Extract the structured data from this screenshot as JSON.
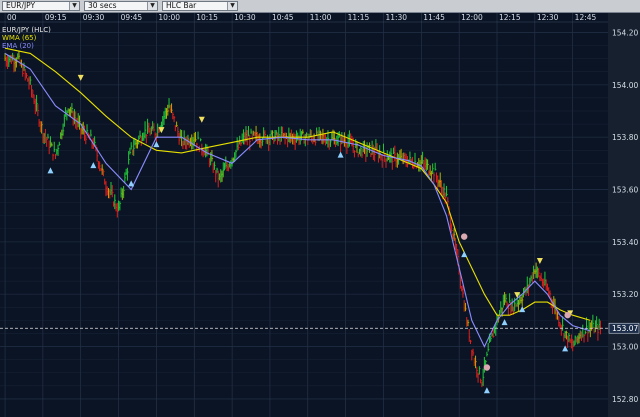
{
  "toolbar": {
    "symbol": {
      "value": "EUR/JPY"
    },
    "interval": {
      "value": "30 secs"
    },
    "chart_type": {
      "value": "HLC Bar"
    },
    "dropdown_icon": "chevron-down-icon"
  },
  "colors": {
    "background": "#0b1424",
    "grid": "#2a3850",
    "up_bar": "#22c93a",
    "down_bar": "#e0201c",
    "neutral_bar": "#b0b000",
    "wma": "#e8e000",
    "ema": "#8a8cff",
    "price_label": "#1c2d4a",
    "axis_panel": "#16202e"
  },
  "legend": [
    {
      "label": "EUR/JPY (HLC)",
      "color": "#e8e8e8"
    },
    {
      "label": "WMA (65)",
      "color": "#e8e000"
    },
    {
      "label": "EMA (20)",
      "color": "#8a8cff"
    }
  ],
  "chart_data": {
    "type": "line",
    "x_ticks": [
      {
        "label": "00",
        "min": 0
      },
      {
        "label": "09:15",
        "min": 15
      },
      {
        "label": "09:30",
        "min": 30
      },
      {
        "label": "09:45",
        "min": 45
      },
      {
        "label": "10:00",
        "min": 60
      },
      {
        "label": "10:15",
        "min": 75
      },
      {
        "label": "10:30",
        "min": 90
      },
      {
        "label": "10:45",
        "min": 105
      },
      {
        "label": "11:00",
        "min": 120
      },
      {
        "label": "11:15",
        "min": 135
      },
      {
        "label": "11:30",
        "min": 150
      },
      {
        "label": "11:45",
        "min": 165
      },
      {
        "label": "12:00",
        "min": 180
      },
      {
        "label": "12:15",
        "min": 195
      },
      {
        "label": "12:30",
        "min": 210
      },
      {
        "label": "12:45",
        "min": 225
      }
    ],
    "y_ticks": [
      "154.20",
      "154.00",
      "153.80",
      "153.60",
      "153.40",
      "153.20",
      "153.00",
      "152.80"
    ],
    "ylim": [
      152.75,
      154.24
    ],
    "current_price": "153.07",
    "series": [
      {
        "name": "EUR/JPY (HLC)",
        "x": [
          0,
          5,
          10,
          15,
          20,
          25,
          30,
          35,
          40,
          45,
          50,
          55,
          60,
          65,
          70,
          75,
          80,
          85,
          90,
          95,
          100,
          105,
          110,
          115,
          120,
          125,
          130,
          135,
          140,
          145,
          150,
          155,
          160,
          165,
          170,
          175,
          180,
          183,
          186,
          189,
          192,
          195,
          198,
          201,
          204,
          207,
          210,
          213,
          216,
          219,
          222,
          225,
          228,
          231,
          236
        ],
        "y": [
          154.1,
          154.1,
          154.0,
          153.82,
          153.73,
          153.92,
          153.83,
          153.78,
          153.62,
          153.52,
          153.75,
          153.82,
          153.82,
          153.92,
          153.78,
          153.8,
          153.74,
          153.64,
          153.72,
          153.8,
          153.8,
          153.8,
          153.8,
          153.8,
          153.8,
          153.8,
          153.79,
          153.79,
          153.75,
          153.75,
          153.73,
          153.72,
          153.71,
          153.7,
          153.67,
          153.57,
          153.3,
          153.1,
          152.95,
          152.87,
          153.0,
          153.1,
          153.18,
          153.15,
          153.18,
          153.22,
          153.3,
          153.25,
          153.2,
          153.12,
          153.05,
          153.0,
          153.05,
          153.07,
          153.07
        ]
      },
      {
        "name": "WMA (65)",
        "x": [
          0,
          10,
          20,
          30,
          40,
          50,
          60,
          70,
          80,
          90,
          100,
          110,
          120,
          130,
          140,
          150,
          160,
          165,
          170,
          175,
          180,
          185,
          190,
          195,
          200,
          205,
          210,
          215,
          220,
          225,
          232
        ],
        "y": [
          154.14,
          154.12,
          154.05,
          153.97,
          153.88,
          153.8,
          153.75,
          153.74,
          153.76,
          153.78,
          153.8,
          153.8,
          153.8,
          153.82,
          153.78,
          153.74,
          153.7,
          153.68,
          153.62,
          153.55,
          153.4,
          153.3,
          153.2,
          153.12,
          153.12,
          153.14,
          153.17,
          153.17,
          153.14,
          153.12,
          153.1
        ]
      },
      {
        "name": "EMA (20)",
        "x": [
          0,
          10,
          20,
          30,
          40,
          50,
          60,
          70,
          80,
          90,
          100,
          110,
          120,
          130,
          140,
          150,
          160,
          165,
          170,
          175,
          180,
          185,
          190,
          195,
          200,
          205,
          210,
          215,
          220,
          225,
          232
        ],
        "y": [
          154.12,
          154.06,
          153.92,
          153.85,
          153.7,
          153.6,
          153.8,
          153.8,
          153.74,
          153.7,
          153.79,
          153.8,
          153.79,
          153.79,
          153.77,
          153.73,
          153.71,
          153.69,
          153.62,
          153.5,
          153.3,
          153.1,
          153.0,
          153.1,
          153.16,
          153.2,
          153.25,
          153.2,
          153.12,
          153.08,
          153.06
        ]
      }
    ],
    "signals": {
      "up": [
        [
          18,
          153.7
        ],
        [
          35,
          153.72
        ],
        [
          50,
          153.65
        ],
        [
          60,
          153.8
        ],
        [
          133,
          153.76
        ],
        [
          182,
          153.38
        ],
        [
          191,
          152.86
        ],
        [
          198,
          153.12
        ],
        [
          205,
          153.17
        ],
        [
          222,
          153.02
        ]
      ],
      "down": [
        [
          30,
          154.0
        ],
        [
          62,
          153.8
        ],
        [
          78,
          153.84
        ],
        [
          203,
          153.17
        ],
        [
          212,
          153.3
        ],
        [
          224,
          153.1
        ]
      ],
      "exit": [
        [
          182,
          153.42
        ],
        [
          191,
          152.92
        ],
        [
          223,
          153.12
        ]
      ]
    }
  }
}
